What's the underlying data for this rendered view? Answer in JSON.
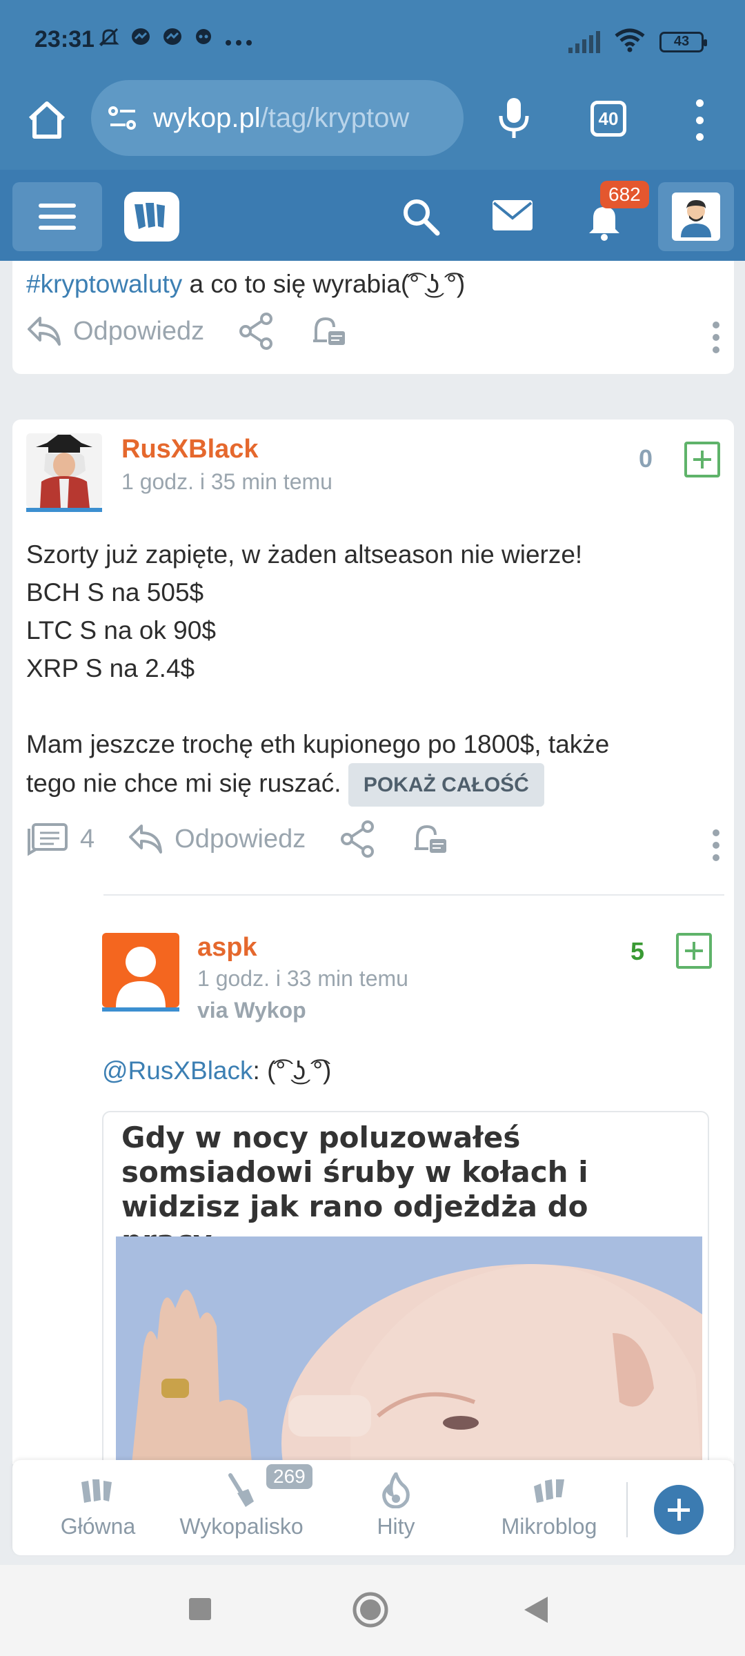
{
  "status_bar": {
    "time": "23:31",
    "battery": "43"
  },
  "browser": {
    "url_host": "wykop.pl",
    "url_path": "/tag/kryptow",
    "tab_count": "40"
  },
  "site_header": {
    "notifications_count": "682"
  },
  "post_prev": {
    "hashtag": "#kryptowaluty",
    "text_rest": " a co to się wyrabia(͡° ͜ʖ ͡°)",
    "reply_label": "Odpowiedz"
  },
  "post_main": {
    "author": "RusXBlack",
    "time": "1 godz. i 35 min temu",
    "score": "0",
    "lines": [
      "Szorty już zapięte, w żaden altseason nie wierze!",
      "BCH S na 505$",
      "LTC S na ok 90$",
      "XRP S na 2.4$",
      "",
      "Mam jeszcze trochę eth kupionego po 1800$, także",
      "tego nie chce mi się ruszać."
    ],
    "show_all_label": "POKAŻ CAŁOŚĆ",
    "comment_count": "4",
    "reply_label": "Odpowiedz"
  },
  "reply": {
    "author": "aspk",
    "time": "1 godz. i 33 min temu",
    "via": "via Wykop",
    "score": "5",
    "mention": "@RusXBlack",
    "text_rest": ": (͡° ͜ʖ ͡°)",
    "meme_caption": "Gdy w nocy poluzowałeś somsiadowi śruby w kołach i widzisz jak rano odjeżdża do pracy"
  },
  "bottom_nav": {
    "items": [
      {
        "label": "Główna"
      },
      {
        "label": "Wykopalisko",
        "badge": "269"
      },
      {
        "label": "Hity"
      },
      {
        "label": "Mikroblog"
      }
    ]
  },
  "colors": {
    "header_blue": "#4383b5",
    "accent_orange": "#e5682d",
    "link_blue": "#3c7fb3",
    "vote_green": "#5fb36a"
  }
}
